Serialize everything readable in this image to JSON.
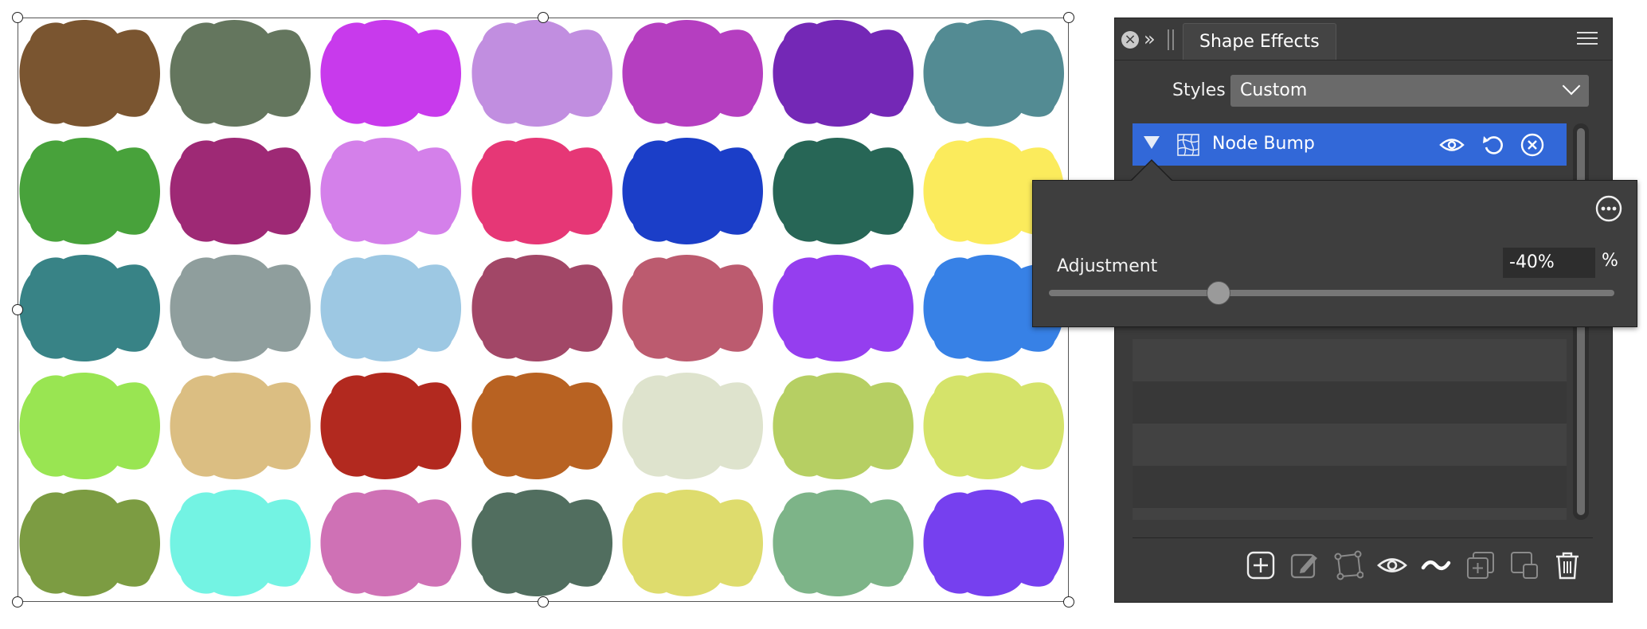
{
  "canvas": {
    "shape_colors": [
      [
        "#7a5530",
        "#64765e",
        "#c83aec",
        "#c18ee0",
        "#b53ec0",
        "#7428b6",
        "#538b93"
      ],
      [
        "#48a23b",
        "#9e2975",
        "#d480ea",
        "#e63776",
        "#1b3ec8",
        "#276656",
        "#fbeb5c"
      ],
      [
        "#388386",
        "#8f9e9d",
        "#9dc8e3",
        "#a24767",
        "#bc5b6f",
        "#953eef",
        "#3781e6"
      ],
      [
        "#99e552",
        "#dbbe82",
        "#b2291f",
        "#b86222",
        "#dee3cd",
        "#b6cf63",
        "#d5e36a"
      ],
      [
        "#7c9c42",
        "#73f3e3",
        "#cf71b5",
        "#516e5f",
        "#dedc6d",
        "#7db488",
        "#7640ef"
      ]
    ]
  },
  "panel": {
    "tab_label": "Shape Effects",
    "styles_label": "Styles",
    "styles_value": "Custom",
    "effect": {
      "label": "Node Bump",
      "selected_color": "#3268d8"
    },
    "popover": {
      "adjustment_label": "Adjustment",
      "adjustment_value": "-40%",
      "adjustment_unit": "%",
      "slider_fraction": 0.3
    },
    "toolbar": [
      "add-icon",
      "edit-icon",
      "node-edit-icon",
      "visibility-icon",
      "wave-icon",
      "duplicate-icon",
      "copy-to-new-icon",
      "trash-icon"
    ]
  }
}
